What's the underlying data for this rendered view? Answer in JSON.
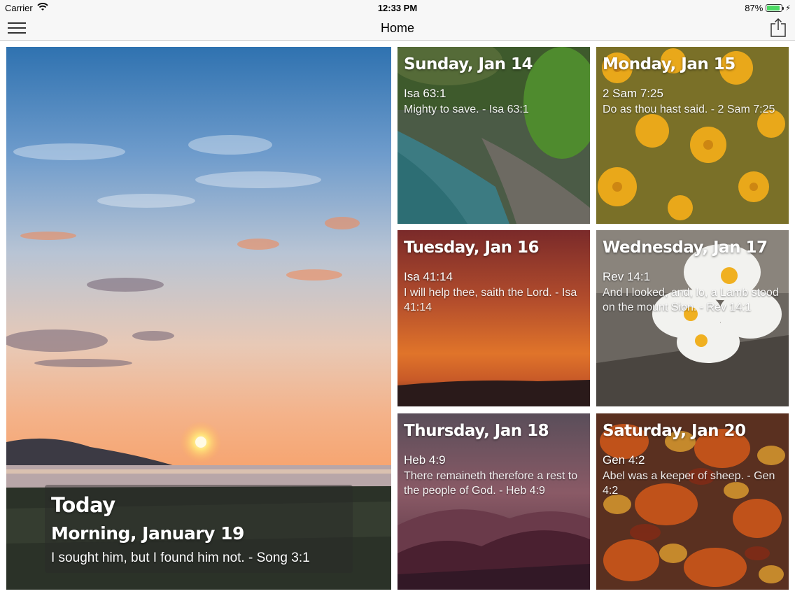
{
  "status_bar": {
    "carrier": "Carrier",
    "time": "12:33 PM",
    "battery": "87%",
    "battery_level": 0.87
  },
  "nav": {
    "title": "Home",
    "menu_icon": "hamburger-menu-icon",
    "share_icon": "share-icon"
  },
  "today": {
    "label": "Today",
    "date": "Morning, January 19",
    "verse": "I sought him, but I found him not. - Song 3:1"
  },
  "tiles": [
    {
      "day": "Sunday, Jan 14",
      "ref": "Isa 63:1",
      "verse": "Mighty to save. - Isa 63:1"
    },
    {
      "day": "Monday, Jan 15",
      "ref": "2 Sam 7:25",
      "verse": "Do as thou hast said. - 2 Sam 7:25"
    },
    {
      "day": "Tuesday, Jan 16",
      "ref": "Isa 41:14",
      "verse": "I will help thee, saith the Lord. - Isa 41:14"
    },
    {
      "day": "Wednesday, Jan 17",
      "ref": "Rev 14:1",
      "verse": "And I looked, and, lo, a Lamb stood on the mount Sion. - Rev 14:1"
    },
    {
      "day": "Thursday, Jan 18",
      "ref": "Heb 4:9",
      "verse": "There remaineth therefore a rest to the people of God. - Heb 4:9"
    },
    {
      "day": "Saturday, Jan 20",
      "ref": "Gen 4:2",
      "verse": "Abel was a keeper of sheep. - Gen 4:2"
    }
  ]
}
